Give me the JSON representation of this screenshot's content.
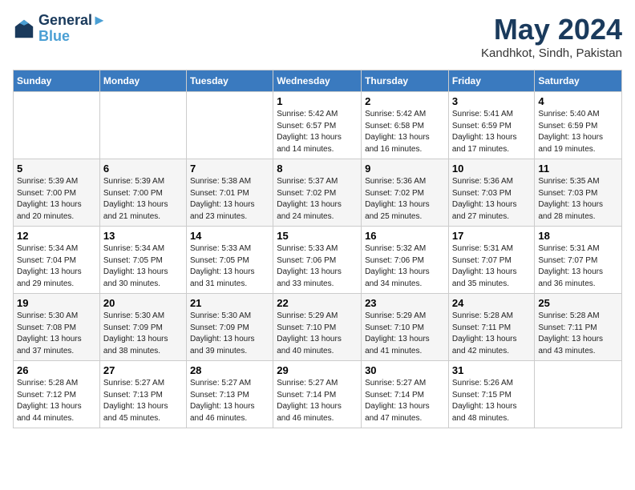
{
  "header": {
    "logo_line1": "General",
    "logo_line2": "Blue",
    "month": "May 2024",
    "location": "Kandhkot, Sindh, Pakistan"
  },
  "weekdays": [
    "Sunday",
    "Monday",
    "Tuesday",
    "Wednesday",
    "Thursday",
    "Friday",
    "Saturday"
  ],
  "weeks": [
    [
      {
        "day": "",
        "info": ""
      },
      {
        "day": "",
        "info": ""
      },
      {
        "day": "",
        "info": ""
      },
      {
        "day": "1",
        "info": "Sunrise: 5:42 AM\nSunset: 6:57 PM\nDaylight: 13 hours\nand 14 minutes."
      },
      {
        "day": "2",
        "info": "Sunrise: 5:42 AM\nSunset: 6:58 PM\nDaylight: 13 hours\nand 16 minutes."
      },
      {
        "day": "3",
        "info": "Sunrise: 5:41 AM\nSunset: 6:59 PM\nDaylight: 13 hours\nand 17 minutes."
      },
      {
        "day": "4",
        "info": "Sunrise: 5:40 AM\nSunset: 6:59 PM\nDaylight: 13 hours\nand 19 minutes."
      }
    ],
    [
      {
        "day": "5",
        "info": "Sunrise: 5:39 AM\nSunset: 7:00 PM\nDaylight: 13 hours\nand 20 minutes."
      },
      {
        "day": "6",
        "info": "Sunrise: 5:39 AM\nSunset: 7:00 PM\nDaylight: 13 hours\nand 21 minutes."
      },
      {
        "day": "7",
        "info": "Sunrise: 5:38 AM\nSunset: 7:01 PM\nDaylight: 13 hours\nand 23 minutes."
      },
      {
        "day": "8",
        "info": "Sunrise: 5:37 AM\nSunset: 7:02 PM\nDaylight: 13 hours\nand 24 minutes."
      },
      {
        "day": "9",
        "info": "Sunrise: 5:36 AM\nSunset: 7:02 PM\nDaylight: 13 hours\nand 25 minutes."
      },
      {
        "day": "10",
        "info": "Sunrise: 5:36 AM\nSunset: 7:03 PM\nDaylight: 13 hours\nand 27 minutes."
      },
      {
        "day": "11",
        "info": "Sunrise: 5:35 AM\nSunset: 7:03 PM\nDaylight: 13 hours\nand 28 minutes."
      }
    ],
    [
      {
        "day": "12",
        "info": "Sunrise: 5:34 AM\nSunset: 7:04 PM\nDaylight: 13 hours\nand 29 minutes."
      },
      {
        "day": "13",
        "info": "Sunrise: 5:34 AM\nSunset: 7:05 PM\nDaylight: 13 hours\nand 30 minutes."
      },
      {
        "day": "14",
        "info": "Sunrise: 5:33 AM\nSunset: 7:05 PM\nDaylight: 13 hours\nand 31 minutes."
      },
      {
        "day": "15",
        "info": "Sunrise: 5:33 AM\nSunset: 7:06 PM\nDaylight: 13 hours\nand 33 minutes."
      },
      {
        "day": "16",
        "info": "Sunrise: 5:32 AM\nSunset: 7:06 PM\nDaylight: 13 hours\nand 34 minutes."
      },
      {
        "day": "17",
        "info": "Sunrise: 5:31 AM\nSunset: 7:07 PM\nDaylight: 13 hours\nand 35 minutes."
      },
      {
        "day": "18",
        "info": "Sunrise: 5:31 AM\nSunset: 7:07 PM\nDaylight: 13 hours\nand 36 minutes."
      }
    ],
    [
      {
        "day": "19",
        "info": "Sunrise: 5:30 AM\nSunset: 7:08 PM\nDaylight: 13 hours\nand 37 minutes."
      },
      {
        "day": "20",
        "info": "Sunrise: 5:30 AM\nSunset: 7:09 PM\nDaylight: 13 hours\nand 38 minutes."
      },
      {
        "day": "21",
        "info": "Sunrise: 5:30 AM\nSunset: 7:09 PM\nDaylight: 13 hours\nand 39 minutes."
      },
      {
        "day": "22",
        "info": "Sunrise: 5:29 AM\nSunset: 7:10 PM\nDaylight: 13 hours\nand 40 minutes."
      },
      {
        "day": "23",
        "info": "Sunrise: 5:29 AM\nSunset: 7:10 PM\nDaylight: 13 hours\nand 41 minutes."
      },
      {
        "day": "24",
        "info": "Sunrise: 5:28 AM\nSunset: 7:11 PM\nDaylight: 13 hours\nand 42 minutes."
      },
      {
        "day": "25",
        "info": "Sunrise: 5:28 AM\nSunset: 7:11 PM\nDaylight: 13 hours\nand 43 minutes."
      }
    ],
    [
      {
        "day": "26",
        "info": "Sunrise: 5:28 AM\nSunset: 7:12 PM\nDaylight: 13 hours\nand 44 minutes."
      },
      {
        "day": "27",
        "info": "Sunrise: 5:27 AM\nSunset: 7:13 PM\nDaylight: 13 hours\nand 45 minutes."
      },
      {
        "day": "28",
        "info": "Sunrise: 5:27 AM\nSunset: 7:13 PM\nDaylight: 13 hours\nand 46 minutes."
      },
      {
        "day": "29",
        "info": "Sunrise: 5:27 AM\nSunset: 7:14 PM\nDaylight: 13 hours\nand 46 minutes."
      },
      {
        "day": "30",
        "info": "Sunrise: 5:27 AM\nSunset: 7:14 PM\nDaylight: 13 hours\nand 47 minutes."
      },
      {
        "day": "31",
        "info": "Sunrise: 5:26 AM\nSunset: 7:15 PM\nDaylight: 13 hours\nand 48 minutes."
      },
      {
        "day": "",
        "info": ""
      }
    ]
  ]
}
